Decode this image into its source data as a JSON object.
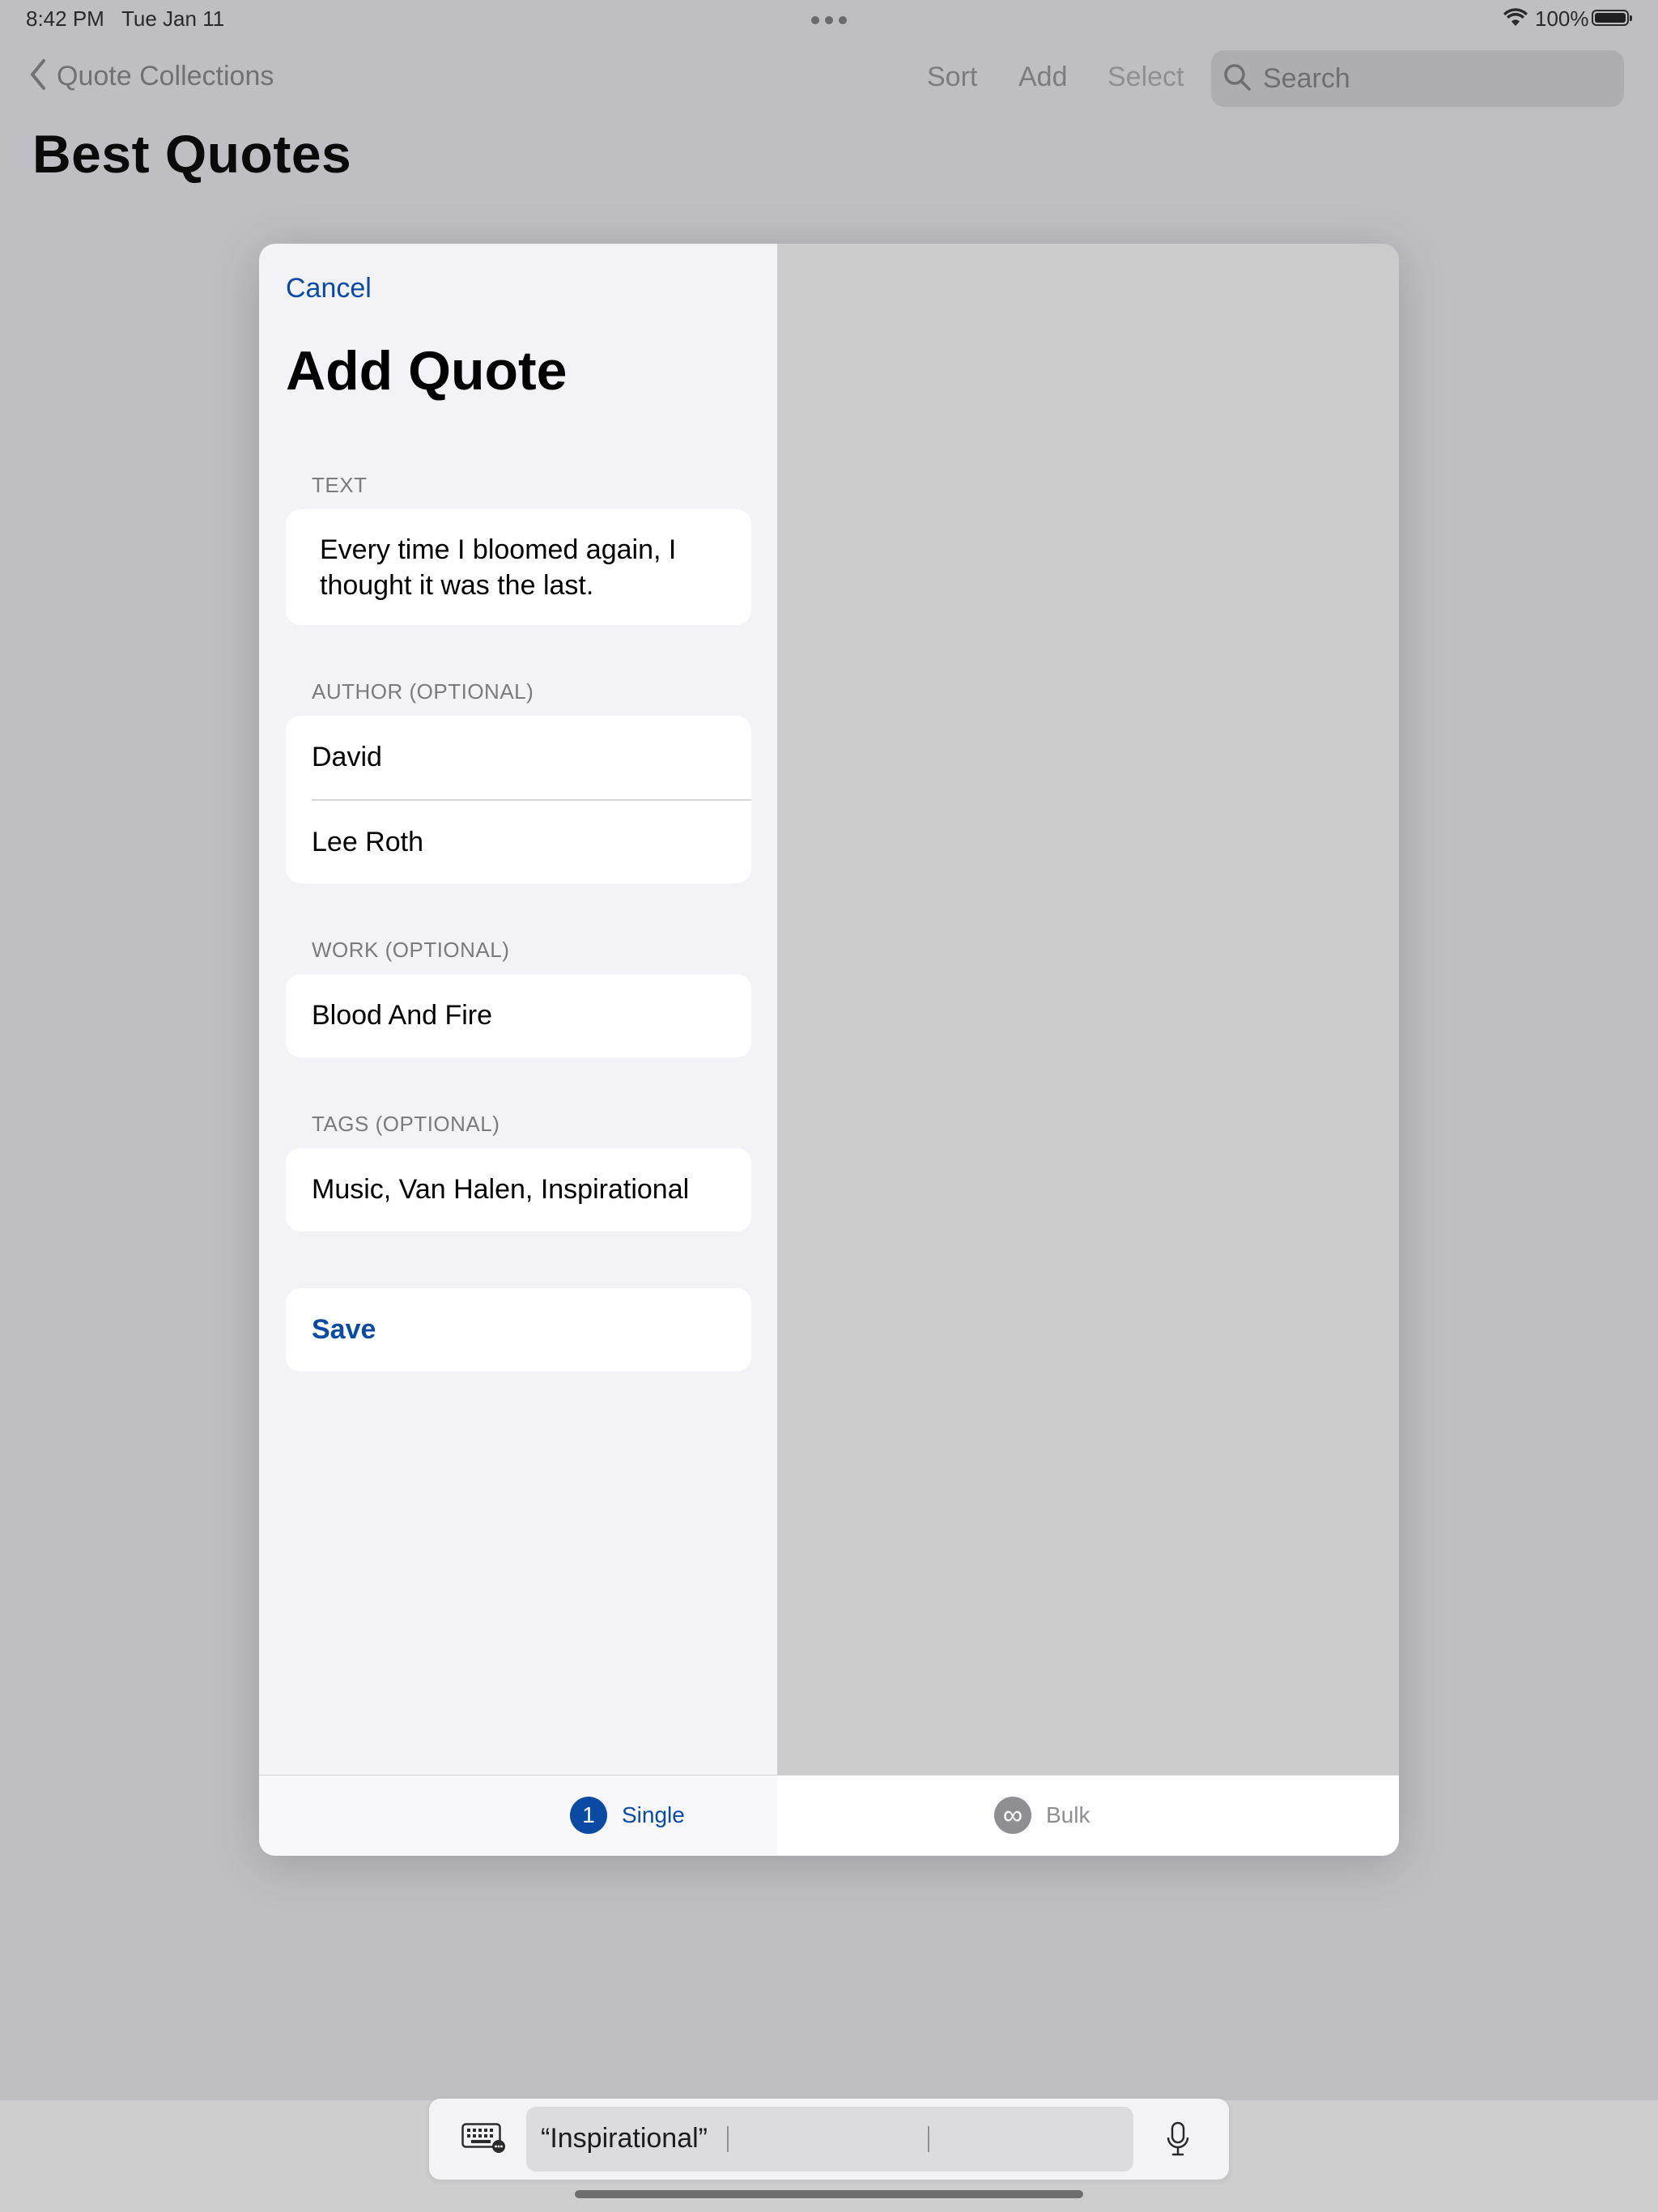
{
  "status": {
    "time": "8:42 PM",
    "date": "Tue Jan 11",
    "battery": "100%"
  },
  "nav": {
    "back_label": "Quote Collections",
    "sort": "Sort",
    "add": "Add",
    "select": "Select",
    "search_placeholder": "Search",
    "page_title": "Best Quotes"
  },
  "modal": {
    "cancel": "Cancel",
    "title": "Add Quote",
    "text_header": "TEXT",
    "text_value": "Every time I bloomed again, I thought it was the last.",
    "author_header": "AUTHOR (OPTIONAL)",
    "author_first": "David",
    "author_last": "Lee Roth",
    "work_header": "WORK (OPTIONAL)",
    "work_value": "Blood And Fire",
    "tags_header": "TAGS (OPTIONAL)",
    "tags_value": "Music, Van Halen, Inspirational",
    "save": "Save"
  },
  "tabs": [
    {
      "label": "Single",
      "badge": "1",
      "selected": true
    },
    {
      "label": "Bulk",
      "badge": "∞",
      "selected": false
    }
  ],
  "keyboard": {
    "suggestion": "“Inspirational”"
  },
  "colors": {
    "accent": "#0b4aa3",
    "inactive": "#8e8e93"
  }
}
